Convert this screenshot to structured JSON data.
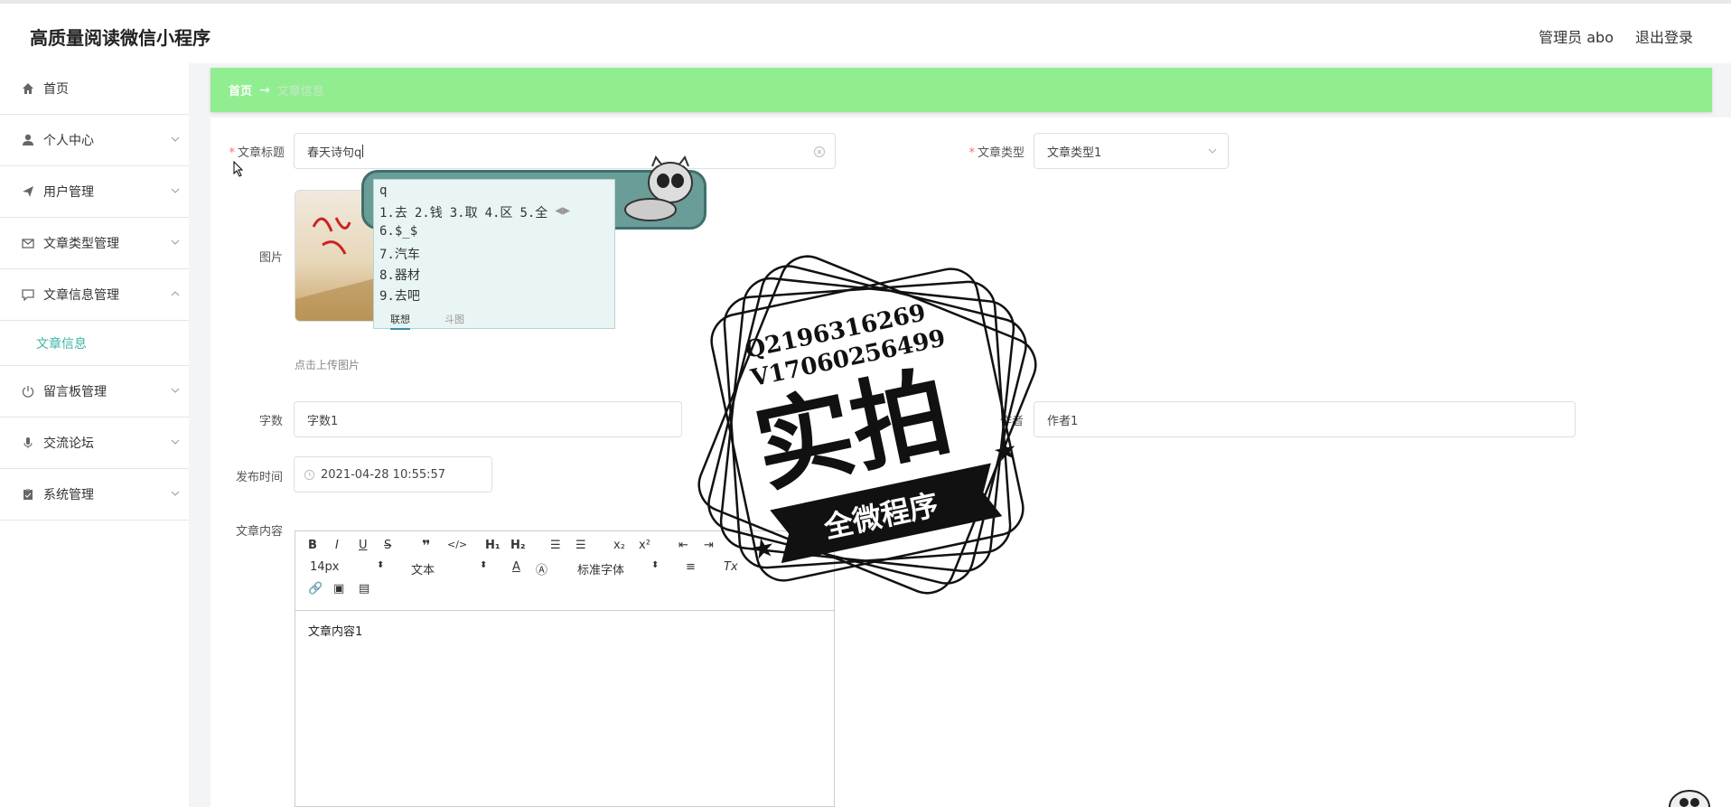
{
  "header": {
    "app_title": "高质量阅读微信小程序",
    "user_label": "管理员 abo",
    "logout_label": "退出登录"
  },
  "sidebar": {
    "items": [
      {
        "label": "首页",
        "icon": "home-icon"
      },
      {
        "label": "个人中心",
        "icon": "user-icon"
      },
      {
        "label": "用户管理",
        "icon": "send-icon"
      },
      {
        "label": "文章类型管理",
        "icon": "mail-icon"
      },
      {
        "label": "文章信息管理",
        "icon": "chat-icon"
      },
      {
        "label": "留言板管理",
        "icon": "power-icon"
      },
      {
        "label": "交流论坛",
        "icon": "mic-icon"
      },
      {
        "label": "系统管理",
        "icon": "clipboard-icon"
      }
    ],
    "active_sub": "文章信息"
  },
  "breadcrumb": {
    "home": "首页",
    "arrow": "→",
    "current": "文章信息"
  },
  "form": {
    "title_label": "文章标题",
    "title_value": "春天诗句q",
    "type_label": "文章类型",
    "type_value": "文章类型1",
    "image_label": "图片",
    "upload_hint": "点击上传图片",
    "words_label": "字数",
    "words_value": "字数1",
    "author_label": "作者",
    "author_value": "作者1",
    "publish_label": "发布时间",
    "publish_value": "2021-04-28 10:55:57",
    "content_label": "文章内容",
    "content_value": "文章内容1"
  },
  "editor_toolbar": {
    "font_size": "14px",
    "block_type": "文本",
    "font_family": "标准字体"
  },
  "ime": {
    "input": "q",
    "row1": [
      "1.去",
      "2.钱",
      "3.取",
      "4.区",
      "5.全"
    ],
    "rows": [
      "6.$_$",
      "7.汽车",
      "8.器材",
      "9.去吧"
    ],
    "tab_active": "联想",
    "tab_other": "斗图"
  },
  "stamp": {
    "line1": "Q2196316269",
    "line2": "V17060256499",
    "big": "实拍",
    "ribbon": "全微程序"
  }
}
